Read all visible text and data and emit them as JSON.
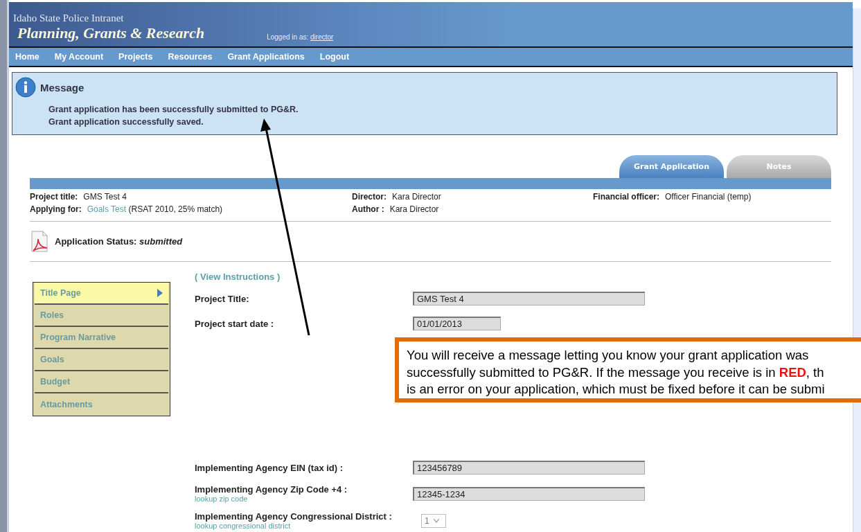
{
  "header": {
    "subtitle": "Idaho State Police Intranet",
    "title": "Planning, Grants & Research",
    "logged_in_label": "Logged in as:",
    "logged_in_user": "director"
  },
  "nav": [
    "Home",
    "My Account",
    "Projects",
    "Resources",
    "Grant Applications",
    "Logout"
  ],
  "message": {
    "title": "Message",
    "lines": [
      "Grant application has been successfully submitted to PG&R.",
      "Grant application successfully saved."
    ]
  },
  "tabs": [
    {
      "label": "Grant Application",
      "selected": true
    },
    {
      "label": "Notes",
      "selected": false
    }
  ],
  "project": {
    "title_label": "Project title:",
    "title_value": "GMS Test 4",
    "applying_label": "Applying for:",
    "applying_link": "Goals Test",
    "applying_detail": "(RSAT 2010, 25% match)",
    "director_label": "Director:",
    "director_value": "Kara Director",
    "author_label": "Author :",
    "author_value": "Kara Director",
    "financial_label": "Financial officer:",
    "financial_value": "Officer Financial (temp)"
  },
  "status": {
    "label": "Application Status:",
    "value": "submitted"
  },
  "sections": [
    {
      "label": "Title Page",
      "selected": true
    },
    {
      "label": "Roles",
      "selected": false
    },
    {
      "label": "Program Narrative",
      "selected": false
    },
    {
      "label": "Goals",
      "selected": false
    },
    {
      "label": "Budget",
      "selected": false
    },
    {
      "label": "Attachments",
      "selected": false
    }
  ],
  "instructions_link": "( View Instructions )",
  "form_top": [
    {
      "label": "Project Title:",
      "value": "GMS Test 4",
      "kind": "wide"
    },
    {
      "label": "Project start date :",
      "value": "01/01/2013",
      "kind": "short"
    }
  ],
  "form_bottom": [
    {
      "label": "Implementing Agency EIN (tax id) :",
      "value": "123456789",
      "kind": "wide"
    },
    {
      "label": "Implementing Agency Zip Code +4 :",
      "link": "lookup zip code",
      "value": "12345-1234",
      "kind": "wide"
    },
    {
      "label": "Implementing Agency Congressional District :",
      "link": "lookup congressional district",
      "value": "1",
      "kind": "select",
      "disabled": true
    }
  ],
  "callout": {
    "lines": [
      "You will receive a message letting you know your grant application was",
      "successfully submitted to PG&R.  If the message you receive is in **RED**, th",
      "is an error on your application, which must be fixed before it can be submi"
    ]
  }
}
